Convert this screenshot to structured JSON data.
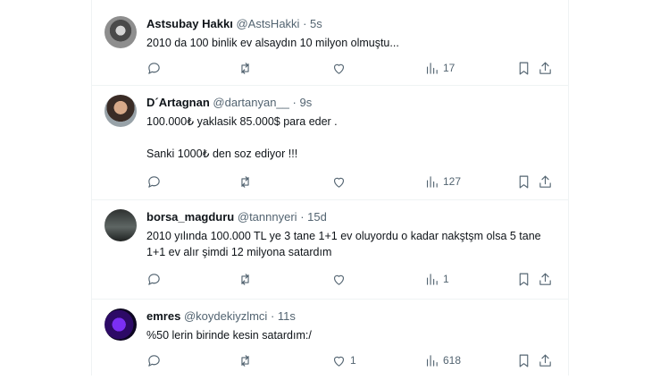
{
  "tweets": [
    {
      "name": "Astsubay Hakkı",
      "handle": "@AstsHakki",
      "time": "5s",
      "text": [
        "2010 da 100 binlik ev alsaydın 10 milyon olmuştu..."
      ],
      "likes": "",
      "views": "17"
    },
    {
      "name": "D´Artagnan",
      "handle": "@dartanyan__",
      "time": "9s",
      "text": [
        "100.000₺ yaklasik 85.000$ para eder .",
        "Sanki 1000₺ den soz ediyor !!!"
      ],
      "likes": "",
      "views": "127"
    },
    {
      "name": "borsa_magduru",
      "handle": "@tannnyeri",
      "time": "15d",
      "text": [
        "2010 yılında 100.000 TL ye 3 tane 1+1 ev oluyordu o kadar nakştşm olsa 5 tane 1+1 ev alır şimdi 12 milyona satardım"
      ],
      "likes": "",
      "views": "1"
    },
    {
      "name": "emres",
      "handle": "@koydekiyzlmci",
      "time": "11s",
      "text": [
        "%50 lerin birinde kesin satardım:/"
      ],
      "likes": "1",
      "views": "618"
    }
  ],
  "separator": "·",
  "icons": [
    "reply-icon",
    "retweet-icon",
    "like-icon",
    "views-icon",
    "bookmark-icon",
    "share-icon"
  ]
}
